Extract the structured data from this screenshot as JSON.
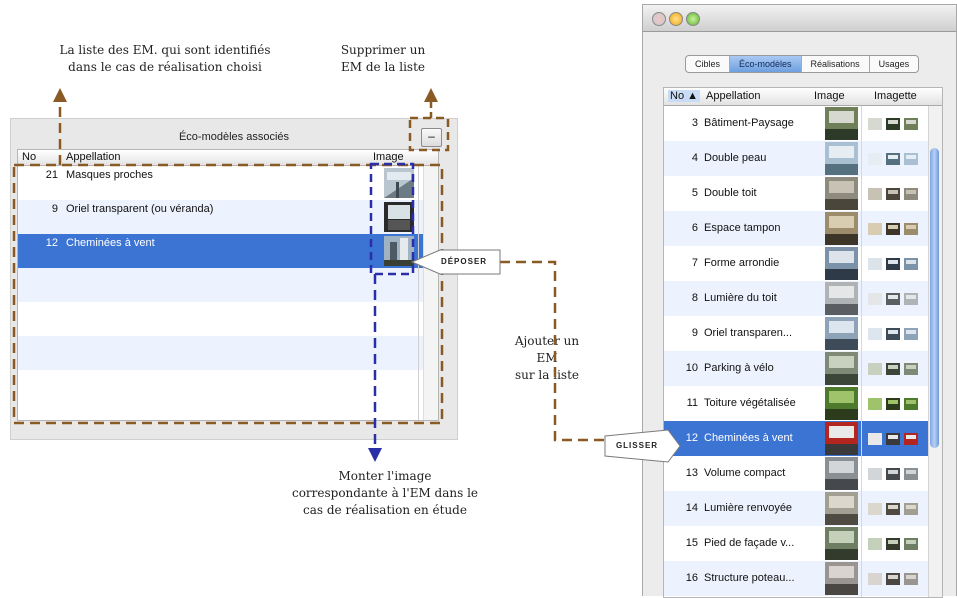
{
  "annotations": {
    "list_desc_line1": "La liste des EM. qui sont identifiés",
    "list_desc_line2": "dans le cas de réalisation choisi",
    "remove_desc_line1": "Supprimer un",
    "remove_desc_line2": "EM de la liste",
    "add_desc_line1": "Ajouter un",
    "add_desc_line2": "EM",
    "add_desc_line3": "sur la  liste",
    "image_desc_line1": "Monter l'image",
    "image_desc_line2": "correspondante à l'EM dans le",
    "image_desc_line3": "cas de réalisation en étude",
    "drop_label": "DÉPOSER",
    "drag_label": "GLISSER"
  },
  "left_panel": {
    "title": "Éco-modèles associés",
    "remove_button": "–",
    "columns": {
      "no": "No",
      "name": "Appellation",
      "image": "Image"
    },
    "rows": [
      {
        "no": "21",
        "name": "Masques proches",
        "selected": false
      },
      {
        "no": "9",
        "name": "Oriel transparent (ou véranda)",
        "selected": false
      },
      {
        "no": "12",
        "name": "Cheminées à vent",
        "selected": true
      }
    ]
  },
  "right_window": {
    "tabs": [
      {
        "label": "Cibles",
        "active": false
      },
      {
        "label": "Éco-modèles",
        "active": true
      },
      {
        "label": "Réalisations",
        "active": false
      },
      {
        "label": "Usages",
        "active": false
      }
    ],
    "columns": {
      "no": "No ▲",
      "name": "Appellation",
      "image": "Image",
      "thumb": "Imagette"
    },
    "rows": [
      {
        "no": "3",
        "name": "Bâtiment-Paysage",
        "selected": false
      },
      {
        "no": "4",
        "name": "Double peau",
        "selected": false
      },
      {
        "no": "5",
        "name": "Double toit",
        "selected": false
      },
      {
        "no": "6",
        "name": "Espace tampon",
        "selected": false
      },
      {
        "no": "7",
        "name": "Forme arrondie",
        "selected": false
      },
      {
        "no": "8",
        "name": "Lumière du toit",
        "selected": false
      },
      {
        "no": "9",
        "name": "Oriel transparen...",
        "selected": false
      },
      {
        "no": "10",
        "name": "Parking à vélo",
        "selected": false
      },
      {
        "no": "11",
        "name": "Toiture végétalisée",
        "selected": false
      },
      {
        "no": "12",
        "name": "Cheminées à vent",
        "selected": true
      },
      {
        "no": "13",
        "name": "Volume compact",
        "selected": false
      },
      {
        "no": "14",
        "name": "Lumière renvoyée",
        "selected": false
      },
      {
        "no": "15",
        "name": "Pied de façade v...",
        "selected": false
      },
      {
        "no": "16",
        "name": "Structure poteau...",
        "selected": false
      }
    ]
  },
  "colors": {
    "selection": "#3c74d4",
    "arrow_brown": "#8a5a25",
    "arrow_blue": "#2a2fa8"
  }
}
